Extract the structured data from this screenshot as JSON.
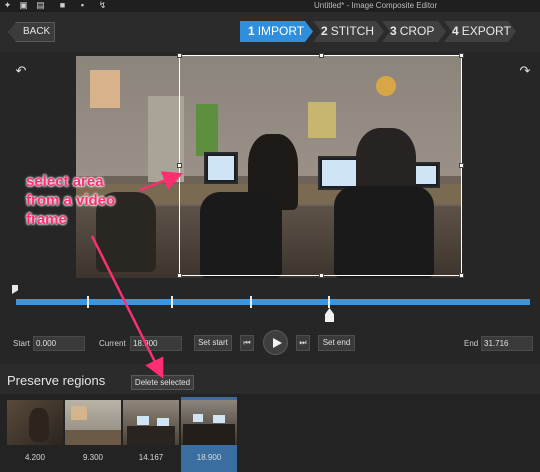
{
  "window": {
    "title": "Untitled* - Image Composite Editor",
    "quick_access_icons": [
      "new-project-icon",
      "new-panorama-icon",
      "open-icon",
      "save-icon",
      "export-icon",
      "settings-icon"
    ]
  },
  "nav": {
    "back_label": "BACK",
    "steps": [
      {
        "num": "1",
        "label": "IMPORT",
        "active": true
      },
      {
        "num": "2",
        "label": "STITCH",
        "active": false
      },
      {
        "num": "3",
        "label": "CROP",
        "active": false
      },
      {
        "num": "4",
        "label": "EXPORT",
        "active": false
      }
    ]
  },
  "workspace": {
    "rotate_left_icon": "rotate-left-icon",
    "rotate_right_icon": "rotate-right-icon"
  },
  "timeline": {
    "keyframe_icon": "keyframe-marker-icon"
  },
  "controls": {
    "start_label": "Start",
    "start_value": "0.000",
    "current_label": "Current",
    "current_value": "18.900",
    "set_start_label": "Set start",
    "set_end_label": "Set end",
    "end_label": "End",
    "end_value": "31.716"
  },
  "regions": {
    "title": "Preserve regions",
    "delete_label": "Delete selected",
    "thumbnails": [
      {
        "time": "4.200",
        "selected": false
      },
      {
        "time": "9.300",
        "selected": false
      },
      {
        "time": "14.167",
        "selected": false
      },
      {
        "time": "18.900",
        "selected": true
      }
    ]
  },
  "annotation": {
    "text": "select area\nfrom a video\nframe",
    "color": "#ff2e72"
  },
  "colors": {
    "accent": "#2f8fdc",
    "timeline": "#3a96e0",
    "background": "#2b2b2b"
  }
}
